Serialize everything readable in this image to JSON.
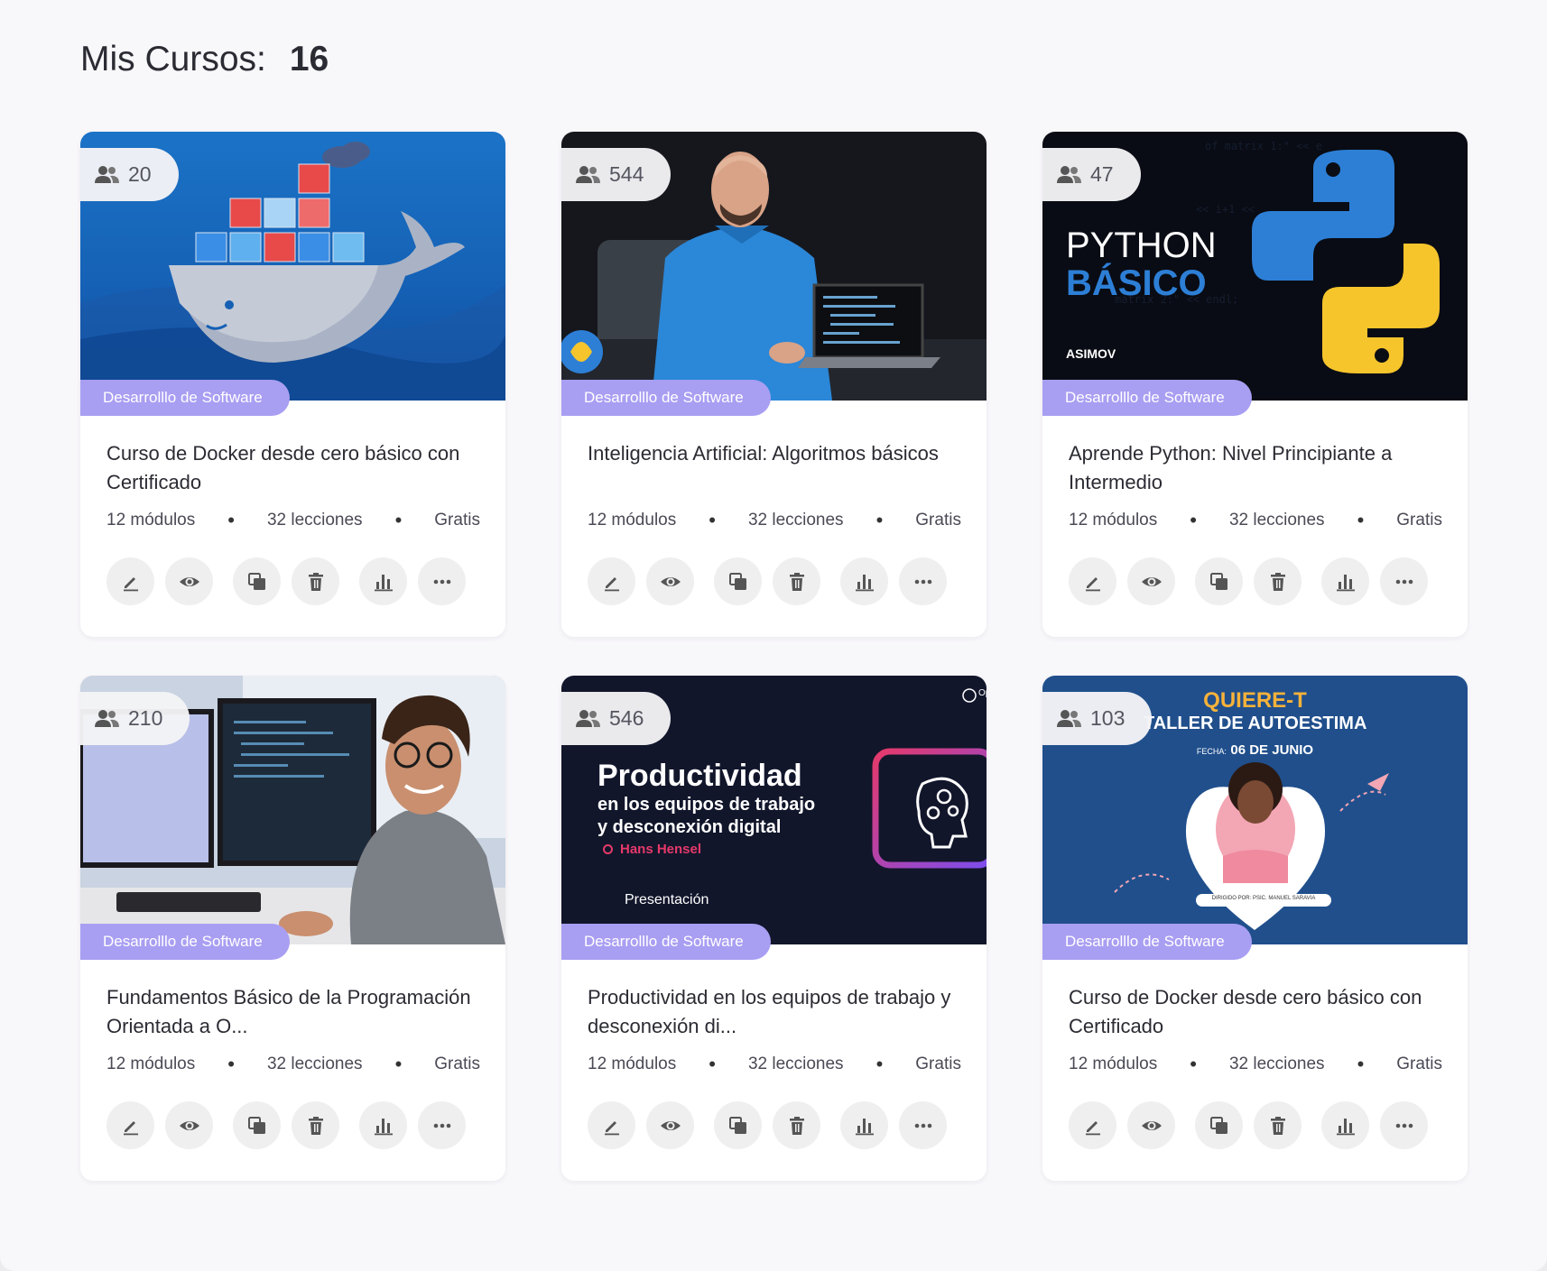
{
  "header": {
    "label": "Mis Cursos:",
    "count": "16"
  },
  "courses": [
    {
      "students": "20",
      "category": "Desarrolllo de Software",
      "title": "Curso de Docker desde cero básico con Certificado",
      "modules": "12 módulos",
      "lessons": "32 lecciones",
      "price": "Gratis"
    },
    {
      "students": "544",
      "category": "Desarrolllo de Software",
      "title": "Inteligencia Artificial: Algoritmos básicos",
      "modules": "12 módulos",
      "lessons": "32 lecciones",
      "price": "Gratis"
    },
    {
      "students": "47",
      "category": "Desarrolllo de Software",
      "title": "Aprende Python: Nivel Principiante a Intermedio",
      "modules": "12 módulos",
      "lessons": "32 lecciones",
      "price": "Gratis",
      "thumb": {
        "line1": "PYTHON",
        "line2": "BÁSICO",
        "brand": "ASIMOV"
      }
    },
    {
      "students": "210",
      "category": "Desarrolllo de Software",
      "title": "Fundamentos Básico de la Programación Orientada a O...",
      "modules": "12 módulos",
      "lessons": "32 lecciones",
      "price": "Gratis"
    },
    {
      "students": "546",
      "category": "Desarrolllo de Software",
      "title": "Productividad en los equipos de trabajo y desconexión di...",
      "modules": "12 módulos",
      "lessons": "32 lecciones",
      "price": "Gratis",
      "thumb": {
        "headline": "Productividad",
        "sub1": "en los equipos de trabajo",
        "sub2": "y desconexión digital",
        "author": "Hans Hensel",
        "footer": "Presentación",
        "corner": "Op"
      }
    },
    {
      "students": "103",
      "category": "Desarrolllo de Software",
      "title": "Curso de Docker desde cero básico con Certificado",
      "modules": "12 módulos",
      "lessons": "32 lecciones",
      "price": "Gratis",
      "thumb": {
        "brand": "QUIERE-T",
        "headline": "TALLER DE AUTOESTIMA",
        "date_label": "FECHA:",
        "date": "06 DE JUNIO",
        "credit": "DIRIGIDO POR: PSIC. MANUEL SARAVIA"
      }
    }
  ],
  "colors": {
    "category_badge": "#a89ef2",
    "background": "#f8f7fa",
    "python_blue": "#2d7fd6",
    "python_yellow": "#f6c52c",
    "prod_pink": "#e5396a"
  },
  "icons": [
    "users-icon",
    "edit-icon",
    "eye-icon",
    "copy-icon",
    "trash-icon",
    "stats-icon",
    "more-icon"
  ]
}
